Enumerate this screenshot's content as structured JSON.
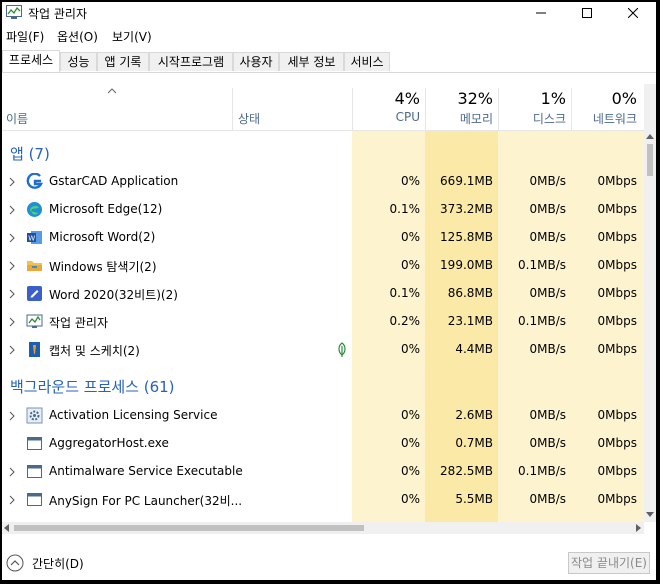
{
  "window": {
    "title": "작업 관리자"
  },
  "menu": [
    "파일(F)",
    "옵션(O)",
    "보기(V)"
  ],
  "tabs": [
    "프로세스",
    "성능",
    "앱 기록",
    "시작프로그램",
    "사용자",
    "세부 정보",
    "서비스"
  ],
  "columns": {
    "name": "이름",
    "status": "상태",
    "cpu": {
      "pct": "4%",
      "label": "CPU"
    },
    "memory": {
      "pct": "32%",
      "label": "메모리"
    },
    "disk": {
      "pct": "1%",
      "label": "디스크"
    },
    "network": {
      "pct": "0%",
      "label": "네트워크"
    }
  },
  "groups": {
    "apps": "앱 (7)",
    "background": "백그라운드 프로세스 (61)"
  },
  "apps": [
    {
      "name": "GstarCAD Application",
      "icon": "gstarcad-icon",
      "cpu": "0%",
      "mem": "669.1MB",
      "disk": "0MB/s",
      "net": "0Mbps"
    },
    {
      "name": "Microsoft Edge(12)",
      "icon": "edge-icon",
      "cpu": "0.1%",
      "mem": "373.2MB",
      "disk": "0MB/s",
      "net": "0Mbps"
    },
    {
      "name": "Microsoft Word(2)",
      "icon": "word-icon",
      "cpu": "0%",
      "mem": "125.8MB",
      "disk": "0MB/s",
      "net": "0Mbps"
    },
    {
      "name": "Windows 탐색기(2)",
      "icon": "folder-icon",
      "cpu": "0%",
      "mem": "199.0MB",
      "disk": "0.1MB/s",
      "net": "0Mbps"
    },
    {
      "name": "Word 2020(32비트)(2)",
      "icon": "word2020-icon",
      "cpu": "0.1%",
      "mem": "86.8MB",
      "disk": "0MB/s",
      "net": "0Mbps"
    },
    {
      "name": "작업 관리자",
      "icon": "task-manager-icon",
      "cpu": "0.2%",
      "mem": "23.1MB",
      "disk": "0.1MB/s",
      "net": "0Mbps"
    },
    {
      "name": "캡처 및 스케치(2)",
      "icon": "snip-sketch-icon",
      "cpu": "0%",
      "mem": "4.4MB",
      "disk": "0MB/s",
      "net": "0Mbps"
    }
  ],
  "background": [
    {
      "name": "Activation Licensing Service",
      "icon": "gear-icon",
      "cpu": "0%",
      "mem": "2.6MB",
      "disk": "0MB/s",
      "net": "0Mbps"
    },
    {
      "name": "AggregatorHost.exe",
      "icon": "window-icon",
      "cpu": "0%",
      "mem": "0.7MB",
      "disk": "0MB/s",
      "net": "0Mbps"
    },
    {
      "name": "Antimalware Service Executable",
      "icon": "window-icon",
      "cpu": "0%",
      "mem": "282.5MB",
      "disk": "0.1MB/s",
      "net": "0Mbps"
    },
    {
      "name": "AnySign For PC Launcher(32비...",
      "icon": "window-icon",
      "cpu": "0%",
      "mem": "5.5MB",
      "disk": "0MB/s",
      "net": "0Mbps"
    }
  ],
  "footer": {
    "simple": "간단히(D)",
    "end_task": "작업 끝내기(E)"
  }
}
